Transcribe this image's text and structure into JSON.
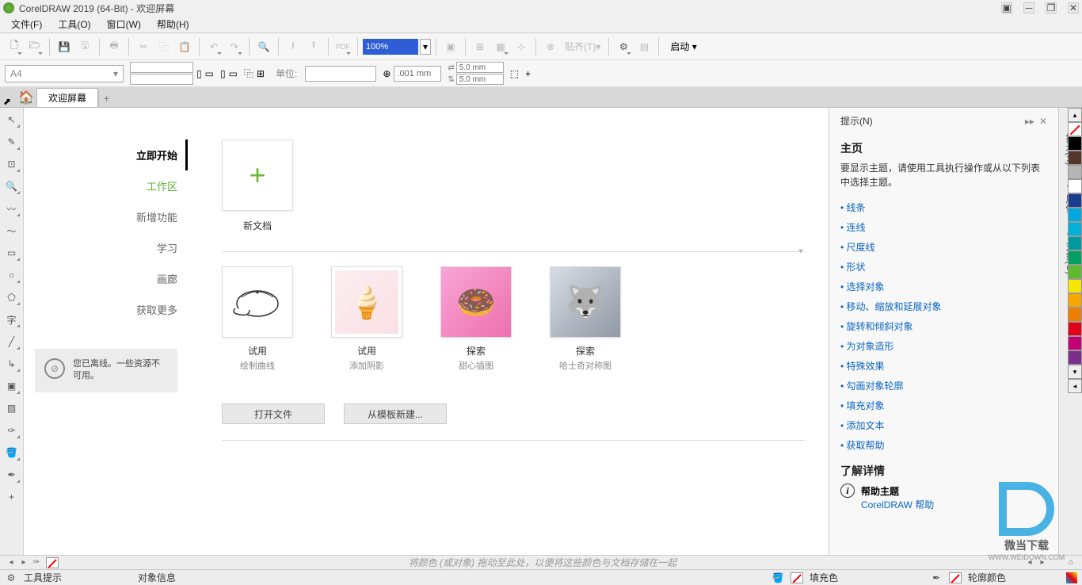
{
  "app": {
    "title": "CorelDRAW 2019 (64-Bit) - 欢迎屏幕"
  },
  "menu": {
    "file": "文件(F)",
    "tools": "工具(O)",
    "window": "窗口(W)",
    "help": "帮助(H)"
  },
  "toolbar": {
    "zoom": "100%",
    "snap_label": "贴齐(T)",
    "launch": "启动"
  },
  "property": {
    "paper": "A4",
    "unit_label": "单位:",
    "nudge_val": ".001 mm",
    "dup_x": "5.0 mm",
    "dup_y": "5.0 mm"
  },
  "tabs": {
    "welcome": "欢迎屏幕"
  },
  "welcome": {
    "sidebar": {
      "start": "立即开始",
      "workspace": "工作区",
      "whatsnew": "新增功能",
      "learn": "学习",
      "gallery": "画廊",
      "getmore": "获取更多"
    },
    "offline": "您已离线。一些资源不可用。",
    "newdoc": "新文档",
    "gallery_items": [
      {
        "label1": "试用",
        "label2": "绘制曲线"
      },
      {
        "label1": "试用",
        "label2": "添加阴影"
      },
      {
        "label1": "探索",
        "label2": "甜心插图"
      },
      {
        "label1": "探索",
        "label2": "哈士奇对称图"
      }
    ],
    "open_file": "打开文件",
    "from_template": "从模板新建..."
  },
  "hints": {
    "panel_title": "提示(N)",
    "main_title": "主页",
    "desc": "要显示主题，请使用工具执行操作或从以下列表中选择主题。",
    "links": [
      "线条",
      "连线",
      "尺度线",
      "形状",
      "选择对象",
      "移动、缩放和延展对象",
      "旋转和倾斜对象",
      "为对象造形",
      "特殊效果",
      "勾画对象轮廓",
      "填充对象",
      "添加文本",
      "获取帮助"
    ],
    "more_title": "了解详情",
    "help_topic": "帮助主题",
    "help_link": "CorelDRAW 帮助"
  },
  "dock_tabs": [
    "提示(N)",
    "属性",
    "对象(O)"
  ],
  "palette_colors": [
    "#000000",
    "#52372a",
    "#b5b5b5",
    "#ffffff",
    "#1a3d8f",
    "#00a7e1",
    "#00b2d9",
    "#009b9f",
    "#00a160",
    "#5fb92f",
    "#f6e600",
    "#f7a600",
    "#ef7d00",
    "#e2001a",
    "#c40076",
    "#7c2e8c"
  ],
  "hscroll": {
    "hint": "将颜色 (或对象) 拖动至此处，以便将这些颜色与文档存储在一起"
  },
  "status": {
    "tool_tip": "工具提示",
    "obj_info": "对象信息",
    "fill": "填充色",
    "outline": "轮廓颜色"
  },
  "watermark": {
    "text": "微当下载",
    "url": "WWW.WEIDOWN.COM"
  }
}
